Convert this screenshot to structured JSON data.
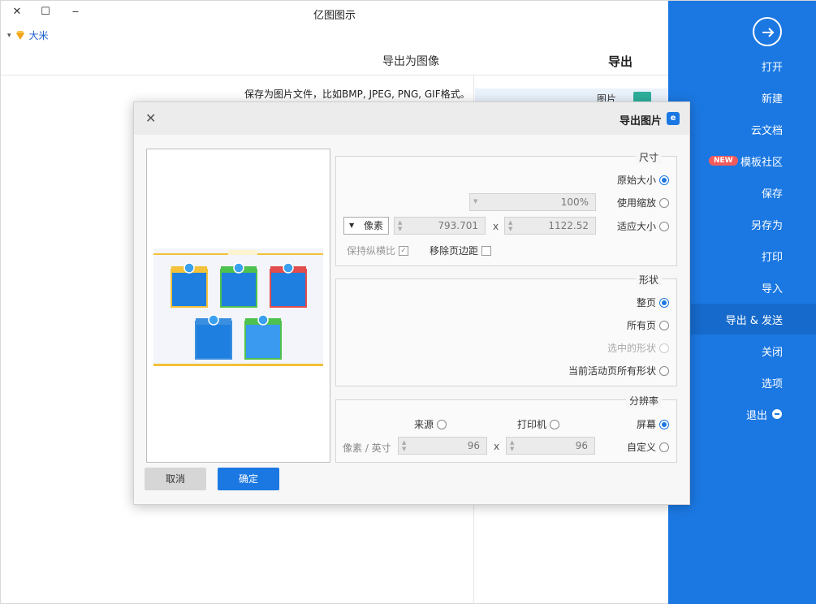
{
  "window": {
    "title": "亿图图示",
    "close_label": "✕",
    "maximize_label": "☐",
    "minimize_label": "‒",
    "user": {
      "caret": "▾",
      "name": "大米"
    }
  },
  "sidebar": {
    "items": [
      {
        "label": "打开"
      },
      {
        "label": "新建"
      },
      {
        "label": "云文档"
      },
      {
        "label": "模板社区",
        "badge": "NEW"
      },
      {
        "label": "保存"
      },
      {
        "label": "另存为"
      },
      {
        "label": "打印"
      },
      {
        "label": "导入"
      },
      {
        "label": "导出 & 发送",
        "active": true
      },
      {
        "label": "关闭"
      },
      {
        "label": "选项"
      },
      {
        "label": "退出"
      }
    ]
  },
  "export_panel": {
    "title": "导出",
    "subtitle": "导出为图像",
    "description": "保存为图片文件，比如BMP, JPEG, PNG, GIF格式。",
    "list_item": "图片"
  },
  "dialog": {
    "title": "导出图片",
    "close_icon": "✕",
    "size": {
      "legend": "尺寸",
      "original_size": "原始大小",
      "use_zoom": "使用缩放",
      "zoom_value": "100%",
      "fit_size": "适应大小",
      "width": "1122.52",
      "height": "793.701",
      "x": "x",
      "unit": "像素",
      "remove_margin": "移除页边距",
      "keep_ratio": "保持纵横比"
    },
    "shape": {
      "legend": "形状",
      "whole_page": "整页",
      "all_pages": "所有页",
      "selected_shapes": "选中的形状",
      "current_page_shapes": "当前活动页所有形状"
    },
    "resolution": {
      "legend": "分辨率",
      "screen": "屏幕",
      "printer": "打印机",
      "source": "来源",
      "custom": "自定义",
      "dpi_x": "96",
      "x": "x",
      "dpi_y": "96",
      "unit": "像素 / 英寸"
    },
    "ok_label": "确定",
    "cancel_label": "取消"
  },
  "colors": {
    "accent": "#1b78e2",
    "sidebar_active": "#166acb",
    "new_badge": "#f25b5b"
  }
}
